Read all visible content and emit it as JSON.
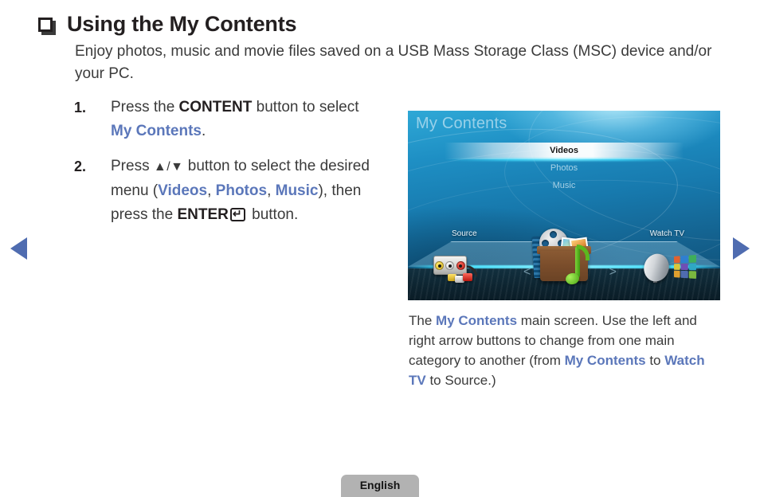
{
  "page": {
    "title": "Using the My Contents",
    "intro": "Enjoy photos, music and movie files saved on a USB Mass Storage Class (MSC) device and/or your PC.",
    "language_label": "English"
  },
  "steps": [
    {
      "number": "1.",
      "segments": [
        {
          "text": "Press the ",
          "style": "normal"
        },
        {
          "text": "CONTENT",
          "style": "bold"
        },
        {
          "text": " button to select ",
          "style": "normal"
        },
        {
          "text": "My Contents",
          "style": "link"
        },
        {
          "text": ".",
          "style": "normal"
        }
      ]
    },
    {
      "number": "2.",
      "segments": [
        {
          "text": "Press ",
          "style": "normal"
        },
        {
          "text": "▲/▼",
          "style": "glyph"
        },
        {
          "text": " button to select the desired menu (",
          "style": "normal"
        },
        {
          "text": "Videos",
          "style": "link"
        },
        {
          "text": ", ",
          "style": "normal"
        },
        {
          "text": "Photos",
          "style": "link"
        },
        {
          "text": ", ",
          "style": "normal"
        },
        {
          "text": "Music",
          "style": "link"
        },
        {
          "text": "), then press the ",
          "style": "normal"
        },
        {
          "text": "ENTER",
          "style": "bold"
        },
        {
          "text": "ENTER-KEY",
          "style": "key"
        },
        {
          "text": " button.",
          "style": "normal"
        }
      ]
    }
  ],
  "tv_screen": {
    "heading": "My Contents",
    "menu": [
      {
        "label": "Videos",
        "selected": true
      },
      {
        "label": "Photos",
        "selected": false
      },
      {
        "label": "Music",
        "selected": false
      }
    ],
    "shelf_left_label": "Source",
    "shelf_right_label": "Watch TV",
    "nav_left": "<",
    "nav_right": ">",
    "icons": {
      "left": "rca-source-icon",
      "center": "media-box-icon",
      "right": "satellite-dish-icon"
    },
    "tile_colors": [
      "#e0622f",
      "#2f7fd0",
      "#3fae5a",
      "#d8c63a",
      "#6f4fb5",
      "#2fa8c4",
      "#e0a02f",
      "#4f6cb0",
      "#7ab83f"
    ]
  },
  "caption": {
    "segments": [
      {
        "text": "The ",
        "style": "normal"
      },
      {
        "text": "My Contents",
        "style": "link"
      },
      {
        "text": " main screen. Use the left and right arrow buttons to change from one main category to another (from ",
        "style": "normal"
      },
      {
        "text": "My Contents",
        "style": "link"
      },
      {
        "text": " to ",
        "style": "normal"
      },
      {
        "text": "Watch TV",
        "style": "link"
      },
      {
        "text": " to Source.)",
        "style": "normal"
      }
    ]
  },
  "navigation": {
    "prev_label": "previous-page",
    "next_label": "next-page"
  },
  "colors": {
    "link_blue": "#5b77ba",
    "arrow_blue": "#4f6cb0",
    "body_text": "#3b3b3b",
    "heading_text": "#231f20",
    "language_tab_bg": "#b2b2b2"
  }
}
